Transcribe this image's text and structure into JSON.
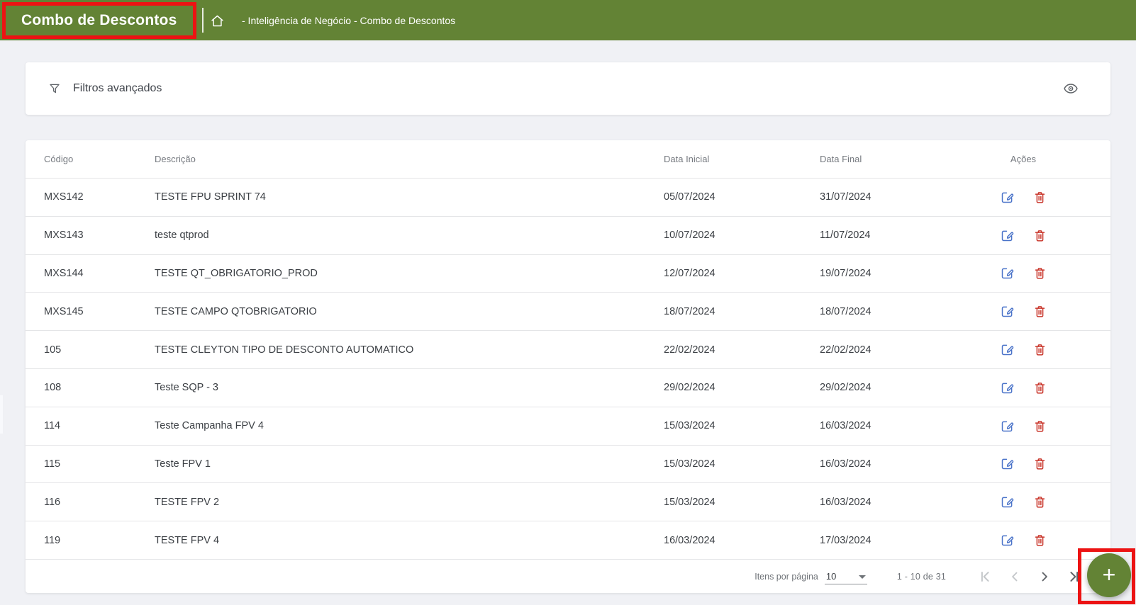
{
  "header": {
    "title": "Combo de Descontos",
    "breadcrumb": "- Inteligência de Negócio - Combo de Descontos"
  },
  "filters": {
    "label": "Filtros avançados"
  },
  "table": {
    "columns": [
      "Código",
      "Descrição",
      "Data Inicial",
      "Data Final",
      "Ações"
    ],
    "rows": [
      {
        "codigo": "MXS142",
        "descricao": "TESTE FPU SPRINT 74",
        "data_inicial": "05/07/2024",
        "data_final": "31/07/2024"
      },
      {
        "codigo": "MXS143",
        "descricao": "teste qtprod",
        "data_inicial": "10/07/2024",
        "data_final": "11/07/2024"
      },
      {
        "codigo": "MXS144",
        "descricao": "TESTE QT_OBRIGATORIO_PROD",
        "data_inicial": "12/07/2024",
        "data_final": "19/07/2024"
      },
      {
        "codigo": "MXS145",
        "descricao": "TESTE CAMPO QTOBRIGATORIO",
        "data_inicial": "18/07/2024",
        "data_final": "18/07/2024"
      },
      {
        "codigo": "105",
        "descricao": "TESTE CLEYTON TIPO DE DESCONTO AUTOMATICO",
        "data_inicial": "22/02/2024",
        "data_final": "22/02/2024"
      },
      {
        "codigo": "108",
        "descricao": "Teste SQP - 3",
        "data_inicial": "29/02/2024",
        "data_final": "29/02/2024"
      },
      {
        "codigo": "114",
        "descricao": "Teste Campanha FPV 4",
        "data_inicial": "15/03/2024",
        "data_final": "16/03/2024"
      },
      {
        "codigo": "115",
        "descricao": "Teste FPV 1",
        "data_inicial": "15/03/2024",
        "data_final": "16/03/2024"
      },
      {
        "codigo": "116",
        "descricao": "TESTE FPV 2",
        "data_inicial": "15/03/2024",
        "data_final": "16/03/2024"
      },
      {
        "codigo": "119",
        "descricao": "TESTE FPV 4",
        "data_inicial": "16/03/2024",
        "data_final": "17/03/2024"
      }
    ]
  },
  "pagination": {
    "items_per_page_label": "Itens por página",
    "items_per_page_value": "10",
    "range_label": "1 - 10 de 31"
  },
  "fab": {
    "plus_label": "+"
  },
  "colors": {
    "primary_green": "#638335",
    "annotation_red": "#ec1313",
    "edit_blue": "#4a73c9",
    "delete_red": "#c9372c",
    "background_gray": "#f0f1f5"
  }
}
